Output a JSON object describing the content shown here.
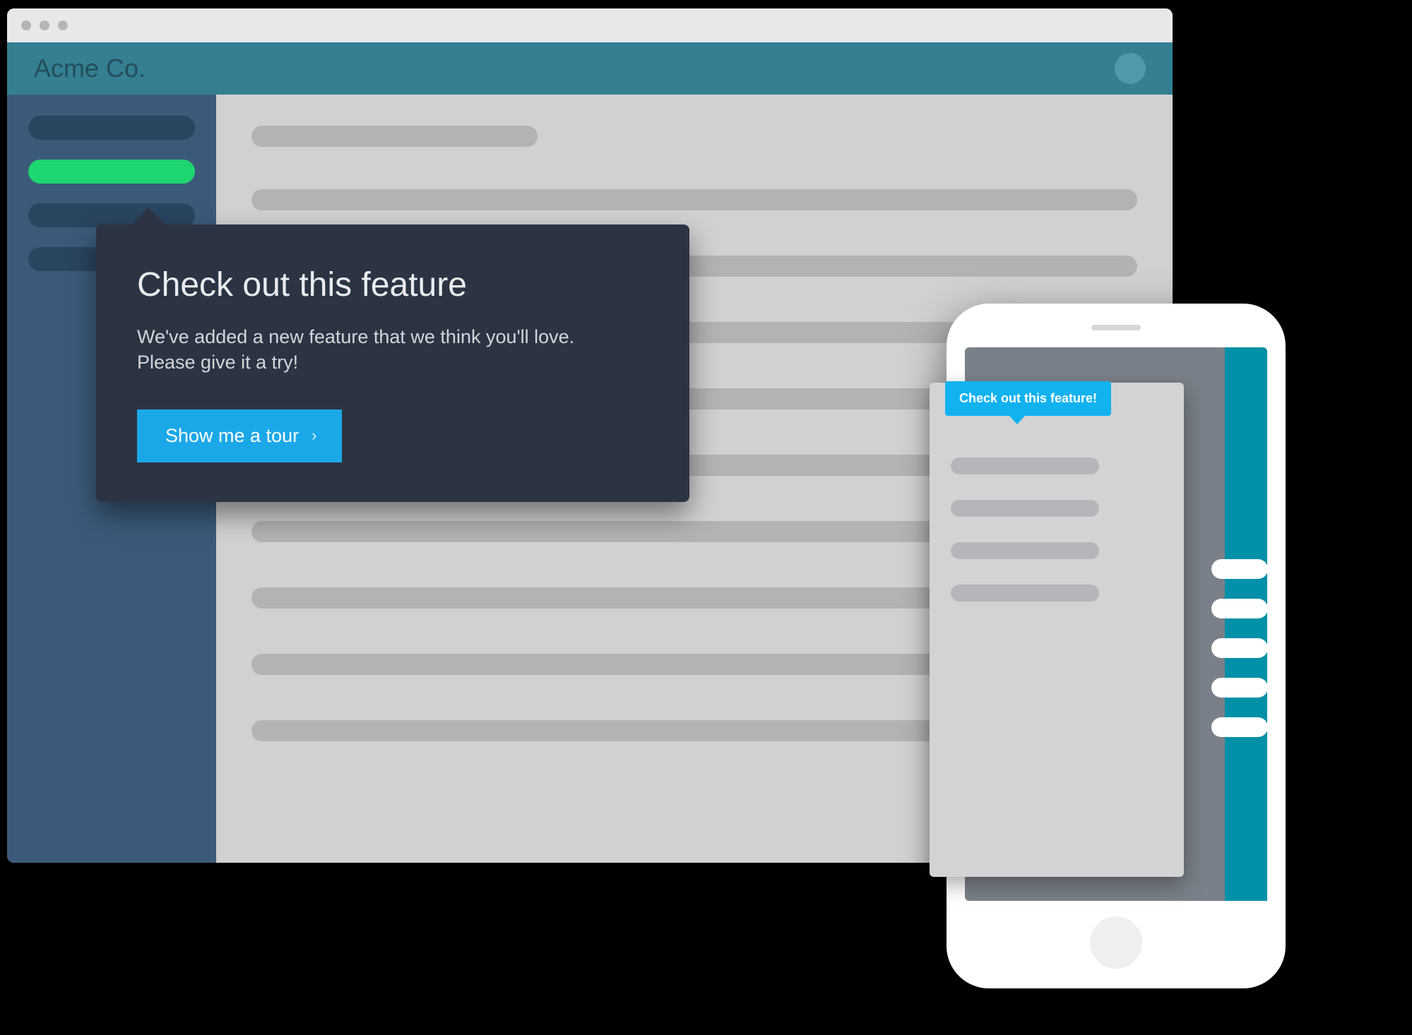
{
  "browser": {
    "app_title": "Acme Co."
  },
  "tooltip": {
    "title": "Check out this feature",
    "body": "We've added a new feature that we think you'll love. Please give it a try!",
    "cta_label": "Show me a tour",
    "cta_glyph": "›"
  },
  "mobile_tooltip": {
    "label": "Check out this feature!"
  }
}
